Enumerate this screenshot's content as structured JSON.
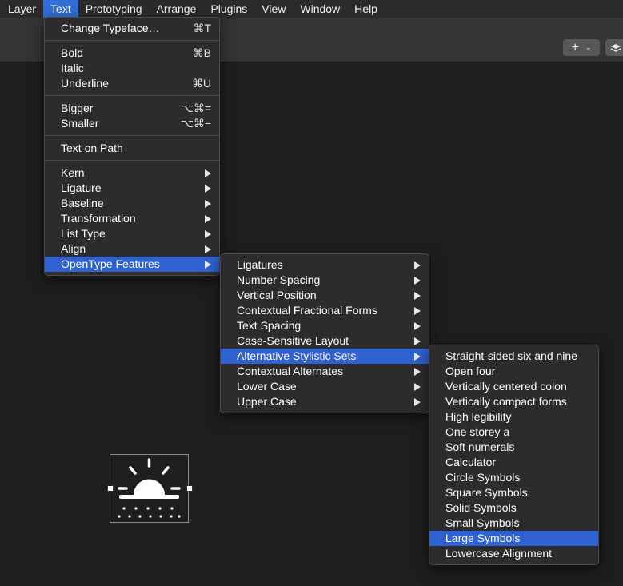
{
  "menubar": {
    "items": [
      "Layer",
      "Text",
      "Prototyping",
      "Arrange",
      "Plugins",
      "View",
      "Window",
      "Help"
    ],
    "active": "Text"
  },
  "toolbar": {
    "add_icon": "plus-icon",
    "chevron_icon": "chevron-down-icon",
    "layers_icon": "layers-icon"
  },
  "text_menu": {
    "groups": [
      [
        {
          "label": "Change Typeface…",
          "shortcut": "⌘T"
        }
      ],
      [
        {
          "label": "Bold",
          "shortcut": "⌘B"
        },
        {
          "label": "Italic",
          "shortcut": ""
        },
        {
          "label": "Underline",
          "shortcut": "⌘U"
        }
      ],
      [
        {
          "label": "Bigger",
          "shortcut": "⌥⌘="
        },
        {
          "label": "Smaller",
          "shortcut": "⌥⌘−"
        }
      ],
      [
        {
          "label": "Text on Path",
          "shortcut": ""
        }
      ],
      [
        {
          "label": "Kern",
          "submenu": true
        },
        {
          "label": "Ligature",
          "submenu": true
        },
        {
          "label": "Baseline",
          "submenu": true
        },
        {
          "label": "Transformation",
          "submenu": true
        },
        {
          "label": "List Type",
          "submenu": true
        },
        {
          "label": "Align",
          "submenu": true
        },
        {
          "label": "OpenType Features",
          "submenu": true,
          "selected": true
        }
      ]
    ]
  },
  "opentype_menu": {
    "items": [
      {
        "label": "Ligatures"
      },
      {
        "label": "Number Spacing"
      },
      {
        "label": "Vertical Position"
      },
      {
        "label": "Contextual Fractional Forms"
      },
      {
        "label": "Text Spacing"
      },
      {
        "label": "Case-Sensitive Layout"
      },
      {
        "label": "Alternative Stylistic Sets",
        "selected": true
      },
      {
        "label": "Contextual Alternates"
      },
      {
        "label": "Lower Case"
      },
      {
        "label": "Upper Case"
      }
    ]
  },
  "stylistic_menu": {
    "items": [
      {
        "label": "Straight-sided six and nine"
      },
      {
        "label": "Open four"
      },
      {
        "label": "Vertically centered colon"
      },
      {
        "label": "Vertically compact forms"
      },
      {
        "label": "High legibility"
      },
      {
        "label": "One storey a"
      },
      {
        "label": "Soft numerals"
      },
      {
        "label": "Calculator"
      },
      {
        "label": "Circle Symbols"
      },
      {
        "label": "Square Symbols"
      },
      {
        "label": "Solid Symbols"
      },
      {
        "label": "Small Symbols"
      },
      {
        "label": "Large Symbols",
        "selected": true
      },
      {
        "label": "Lowercase Alignment"
      }
    ]
  },
  "canvas": {
    "selected_icon": "sunset-icon"
  },
  "colors": {
    "menu_bg": "#2c2c2e",
    "selection": "#2f61d0",
    "canvas_bg": "#1e1e1f",
    "toolbar_bg": "#343436"
  }
}
